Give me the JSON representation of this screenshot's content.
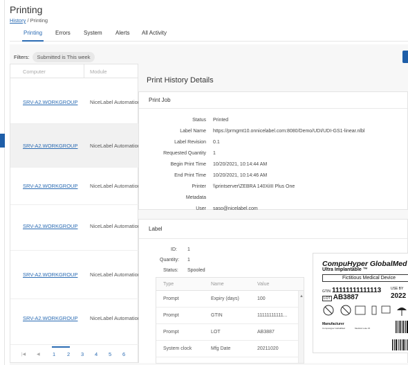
{
  "page": {
    "title": "Printing",
    "breadcrumb": {
      "link": "History",
      "sep": "/",
      "current": "Printing"
    }
  },
  "tabs": [
    {
      "label": "Printing",
      "active": true
    },
    {
      "label": "Errors"
    },
    {
      "label": "System"
    },
    {
      "label": "Alerts"
    },
    {
      "label": "All Activity"
    }
  ],
  "filters": {
    "label": "Filters:",
    "chip": "Submitted is This week"
  },
  "grid": {
    "columns": [
      "Computer",
      "Module"
    ],
    "rows": [
      {
        "computer": "SRV-A2.WORKGROUP",
        "module": "NiceLabel Automation"
      },
      {
        "computer": "SRV-A2.WORKGROUP",
        "module": "NiceLabel Automation",
        "selected": true
      },
      {
        "computer": "SRV-A2.WORKGROUP",
        "module": "NiceLabel Automation"
      },
      {
        "computer": "SRV-A2.WORKGROUP",
        "module": "NiceLabel Automation"
      },
      {
        "computer": "SRV-A2.WORKGROUP",
        "module": "NiceLabel Automation"
      },
      {
        "computer": "SRV-A2.WORKGROUP",
        "module": "NiceLabel Automation"
      }
    ],
    "pager": {
      "pages": [
        "1",
        "2",
        "3",
        "4",
        "5",
        "6"
      ],
      "current": "1"
    }
  },
  "details": {
    "title": "Print History Details",
    "print_job": {
      "heading": "Print Job",
      "fields": [
        {
          "k": "Status",
          "v": "Printed"
        },
        {
          "k": "Label Name",
          "v": "https://prmgmt10.onnicelabel.com:8080/Demo/UDI/UDI-GS1-linear.nlbl"
        },
        {
          "k": "Label Revision",
          "v": "0.1"
        },
        {
          "k": "Requested Quantity",
          "v": "1"
        },
        {
          "k": "Begin Print Time",
          "v": "10/20/2021, 10:14:44 AM"
        },
        {
          "k": "End Print Time",
          "v": "10/20/2021, 10:14:46 AM"
        },
        {
          "k": "Printer",
          "v": "\\\\printserver\\ZEBRA 140XiIII Plus One"
        },
        {
          "k": "Metadata",
          "v": ""
        },
        {
          "k": "User",
          "v": "saso@nicelabel.com"
        }
      ]
    },
    "label": {
      "heading": "Label",
      "id_label": "ID:",
      "id": "1",
      "qty_label": "Quantity:",
      "qty": "1",
      "status_label": "Status:",
      "status": "Spooled",
      "table": {
        "columns": [
          "Type",
          "Name",
          "Value"
        ],
        "rows": [
          {
            "type": "Prompt",
            "name": "Expiry (days)",
            "value": "100"
          },
          {
            "type": "Prompt",
            "name": "GTIN",
            "value": "11111111111..."
          },
          {
            "type": "Prompt",
            "name": "LOT",
            "value": "AB3887"
          },
          {
            "type": "System clock",
            "name": "Mfg Date",
            "value": "20211020"
          }
        ]
      },
      "preview": {
        "title": "CompuHyper GlobalMed",
        "subtitle": "Ultra Implantable ™",
        "box": "Fictitious Medical Device",
        "gtin_prefix": "GTIN",
        "gtin": "11111111111113",
        "lot_prefix": "LOT",
        "lot": "AB3887",
        "use_by": "USE BY",
        "year": "2022",
        "manufacturer": "Manufacturer",
        "fine_left": "CompuHyper GlobalMed",
        "fine_right": "Medical route 15"
      }
    }
  }
}
